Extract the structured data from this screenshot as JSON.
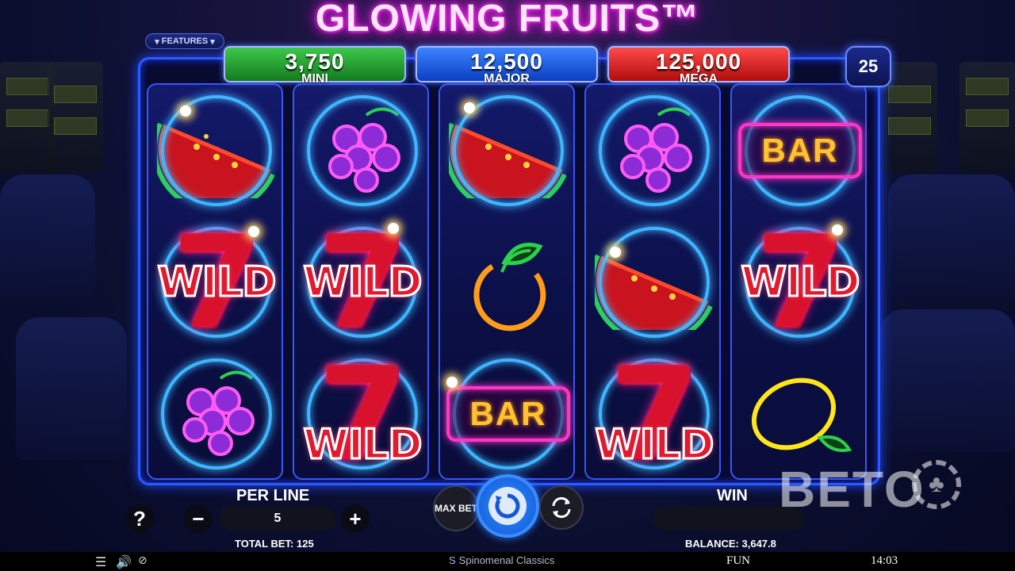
{
  "game": {
    "title": "GLOWING FRUITS™"
  },
  "features_label": "FEATURES",
  "jackpots": {
    "mini": {
      "amount": "3,750",
      "label": "MINI"
    },
    "major": {
      "amount": "12,500",
      "label": "MAJOR"
    },
    "mega": {
      "amount": "125,000",
      "label": "MEGA"
    }
  },
  "paylines": "25",
  "reels": [
    [
      "watermelon",
      "wild-seven",
      "grapes"
    ],
    [
      "grapes",
      "wild-seven",
      "wild-seven"
    ],
    [
      "watermelon",
      "orange",
      "bar"
    ],
    [
      "grapes",
      "watermelon",
      "wild-seven"
    ],
    [
      "bar",
      "wild-seven",
      "lemon"
    ]
  ],
  "symbol_text": {
    "wild": "WILD",
    "seven": "7",
    "bar": "BAR"
  },
  "controls": {
    "help": "?",
    "per_line_label": "PER LINE",
    "per_line_value": "5",
    "minus": "−",
    "plus": "+",
    "total_bet": "TOTAL BET: 125",
    "max_bet": "MAX BET",
    "win_label": "WIN",
    "win_value": "",
    "balance": "BALANCE: 3,647.8"
  },
  "footer": {
    "brand": "Spinomenal Classics",
    "mode": "FUN",
    "time": "14:03"
  },
  "watermark": "BETO",
  "colors": {
    "jackpot_mini": "#2fae3c",
    "jackpot_major": "#1f63ee",
    "jackpot_mega": "#e02525",
    "neon_frame": "#2a5bff"
  }
}
